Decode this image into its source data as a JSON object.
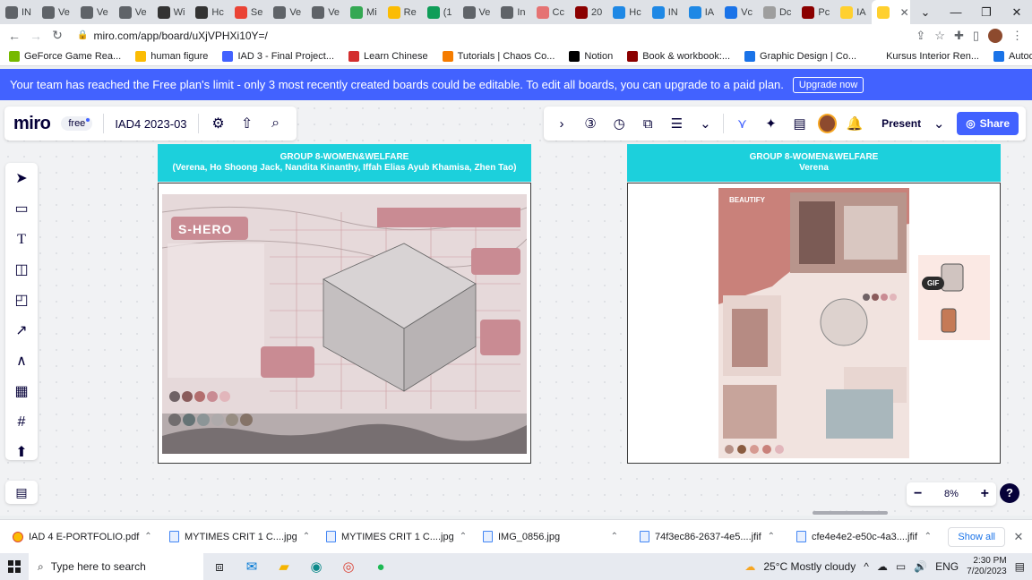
{
  "browser": {
    "tabs": [
      {
        "label": "IN",
        "color": "#5f6368"
      },
      {
        "label": "Ve",
        "color": "#5f6368"
      },
      {
        "label": "Ve",
        "color": "#5f6368"
      },
      {
        "label": "Ve",
        "color": "#5f6368"
      },
      {
        "label": "Wi",
        "color": "#333333"
      },
      {
        "label": "Hc",
        "color": "#333333"
      },
      {
        "label": "Se",
        "color": "#ea4335"
      },
      {
        "label": "Ve",
        "color": "#5f6368"
      },
      {
        "label": "Ve",
        "color": "#5f6368"
      },
      {
        "label": "Mi",
        "color": "#34a853"
      },
      {
        "label": "Re",
        "color": "#fbbc04"
      },
      {
        "label": "(1",
        "color": "#0f9d58"
      },
      {
        "label": "Ve",
        "color": "#5f6368"
      },
      {
        "label": "In",
        "color": "#5f6368"
      },
      {
        "label": "Cc",
        "color": "#e57373"
      },
      {
        "label": "20",
        "color": "#8b0000"
      },
      {
        "label": "Hc",
        "color": "#1e88e5"
      },
      {
        "label": "IN",
        "color": "#1e88e5"
      },
      {
        "label": "IA",
        "color": "#1e88e5"
      },
      {
        "label": "Vc",
        "color": "#1a73e8"
      },
      {
        "label": "Dc",
        "color": "#9e9e9e"
      },
      {
        "label": "Pc",
        "color": "#8b0000"
      },
      {
        "label": "IA",
        "color": "#ffd02f"
      },
      {
        "label": "",
        "color": "#ffd02f",
        "active": true
      }
    ],
    "url": "miro.com/app/board/uXjVPHXi10Y=/",
    "bookmarks": [
      {
        "label": "GeForce Game Rea...",
        "color": "#76b900"
      },
      {
        "label": "human figure",
        "color": "#fbbc04"
      },
      {
        "label": "IAD 3 - Final Project...",
        "color": "#4262ff"
      },
      {
        "label": "Learn Chinese",
        "color": "#d32f2f"
      },
      {
        "label": "Tutorials | Chaos Co...",
        "color": "#f57c00"
      },
      {
        "label": "Notion",
        "color": "#000000"
      },
      {
        "label": "Book & workbook:...",
        "color": "#8b0000"
      },
      {
        "label": "Graphic Design | Co...",
        "color": "#1a73e8"
      },
      {
        "label": "Kursus Interior Ren...",
        "color": "#ffffff"
      },
      {
        "label": "Autodesk Certified...",
        "color": "#1a73e8"
      }
    ]
  },
  "banner": {
    "text": "Your team has reached the Free plan's limit - only 3 most recently created boards could be editable. To edit all boards, you can upgrade to a paid plan.",
    "button": "Upgrade now"
  },
  "miro": {
    "logo": "miro",
    "plan": "free",
    "board_name": "IAD4 2023-03",
    "present": "Present",
    "share": "Share",
    "zoom": "8%",
    "help": "?",
    "colors": {
      "accent": "#4262ff",
      "frame_header": "#1cd0dc",
      "banner": "#4262ff"
    }
  },
  "frames": [
    {
      "title": "GROUP 8-WOMEN&WELFARE",
      "subtitle": "(Verena, Ho Shoong Jack, Nandita Kinanthy, Iffah Elias Ayub Khamisa, Zhen Tao)",
      "poster_title": "S-HERO"
    },
    {
      "title": "GROUP 8-WOMEN&WELFARE",
      "subtitle": "Verena",
      "poster_title": "BEAUTIFY",
      "gif_label": "GIF"
    }
  ],
  "downloads": {
    "items": [
      {
        "name": "IAD 4 E-PORTFOLIO.pdf",
        "icon": "chrome-icon"
      },
      {
        "name": "MYTIMES CRIT 1 C....jpg",
        "icon": "file-icon"
      },
      {
        "name": "MYTIMES CRIT 1 C....jpg",
        "icon": "file-icon"
      },
      {
        "name": "IMG_0856.jpg",
        "icon": "file-icon"
      },
      {
        "name": "74f3ec86-2637-4e5....jfif",
        "icon": "file-icon"
      },
      {
        "name": "cfe4e4e2-e50c-4a3....jfif",
        "icon": "file-icon"
      }
    ],
    "show_all": "Show all"
  },
  "taskbar": {
    "search_placeholder": "Type here to search",
    "weather": "25°C  Mostly cloudy",
    "language": "ENG",
    "time": "2:30 PM",
    "date": "7/20/2023"
  }
}
